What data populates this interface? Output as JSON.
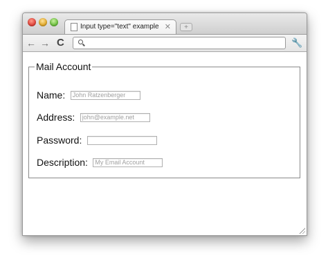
{
  "window": {
    "title": "Input type=\"text\" example"
  },
  "tabs": [
    {
      "label": "Input type=\"text\" example",
      "close": "✕"
    }
  ],
  "newtab": {
    "label": "+"
  },
  "toolbar": {
    "address_value": ""
  },
  "form": {
    "legend": "Mail Account",
    "fields": [
      {
        "label": "Name:",
        "placeholder": "John Ratzenberger",
        "value": ""
      },
      {
        "label": "Address:",
        "placeholder": "john@example.net",
        "value": ""
      },
      {
        "label": "Password:",
        "placeholder": "",
        "value": ""
      },
      {
        "label": "Description:",
        "placeholder": "My Email Account",
        "value": ""
      }
    ]
  },
  "icons": {
    "back": "back-arrow-icon",
    "forward": "forward-arrow-icon",
    "reload": "reload-icon",
    "search": "search-icon",
    "wrench": "wrench-icon",
    "page": "page-icon",
    "resize": "resize-grip-icon"
  },
  "colors": {
    "close_light": "#e0443a",
    "minimize_light": "#e0a82a",
    "zoom_light": "#6cbf3f"
  }
}
